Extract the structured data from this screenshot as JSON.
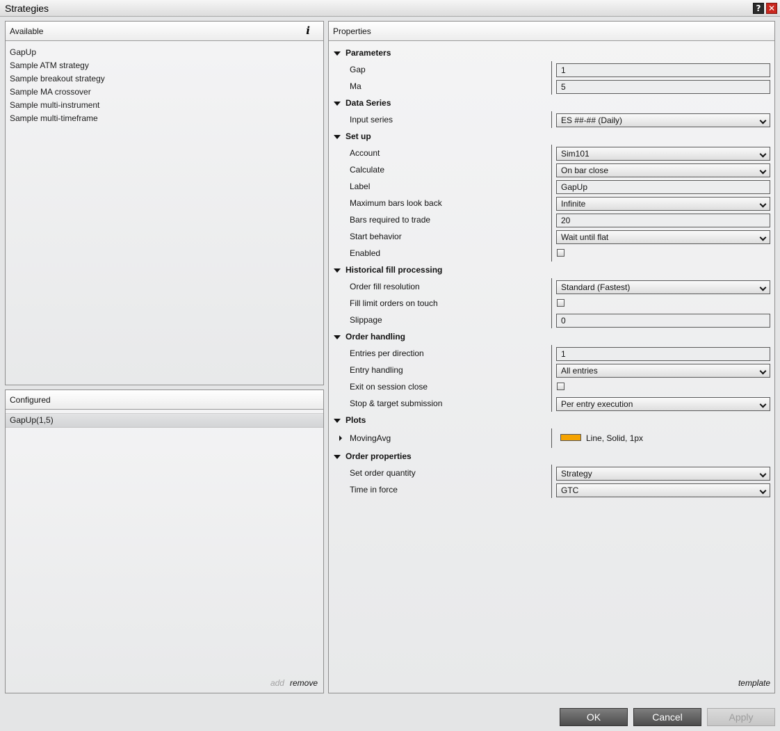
{
  "window": {
    "title": "Strategies",
    "help_label": "?",
    "close_label": "✕"
  },
  "available": {
    "header": "Available",
    "info_label": "i",
    "items": [
      "GapUp",
      "Sample ATM strategy",
      "Sample breakout strategy",
      "Sample MA crossover",
      "Sample multi-instrument",
      "Sample multi-timeframe"
    ]
  },
  "configured": {
    "header": "Configured",
    "items": [
      "GapUp(1,5)"
    ],
    "add_label": "add",
    "remove_label": "remove"
  },
  "properties": {
    "header": "Properties",
    "template_label": "template",
    "sections": {
      "parameters": {
        "title": "Parameters",
        "gap": {
          "label": "Gap",
          "value": "1"
        },
        "ma": {
          "label": "Ma",
          "value": "5"
        }
      },
      "data_series": {
        "title": "Data Series",
        "input_series": {
          "label": "Input series",
          "value": "ES ##-## (Daily)"
        }
      },
      "setup": {
        "title": "Set up",
        "account": {
          "label": "Account",
          "value": "Sim101"
        },
        "calculate": {
          "label": "Calculate",
          "value": "On bar close"
        },
        "label_field": {
          "label": "Label",
          "value": "GapUp"
        },
        "max_bars_look_back": {
          "label": "Maximum bars look back",
          "value": "Infinite"
        },
        "bars_required": {
          "label": "Bars required to trade",
          "value": "20"
        },
        "start_behavior": {
          "label": "Start behavior",
          "value": "Wait until flat"
        },
        "enabled": {
          "label": "Enabled",
          "checked": false
        }
      },
      "historical_fill": {
        "title": "Historical fill processing",
        "order_fill_resolution": {
          "label": "Order fill resolution",
          "value": "Standard (Fastest)"
        },
        "fill_limit_on_touch": {
          "label": "Fill limit orders on touch",
          "checked": false
        },
        "slippage": {
          "label": "Slippage",
          "value": "0"
        }
      },
      "order_handling": {
        "title": "Order handling",
        "entries_per_direction": {
          "label": "Entries per direction",
          "value": "1"
        },
        "entry_handling": {
          "label": "Entry handling",
          "value": "All entries"
        },
        "exit_on_session_close": {
          "label": "Exit on session close",
          "checked": false
        },
        "stop_target_submission": {
          "label": "Stop & target submission",
          "value": "Per entry execution"
        }
      },
      "plots": {
        "title": "Plots",
        "moving_avg": {
          "label": "MovingAvg",
          "value": "Line, Solid, 1px",
          "color": "#f5a300"
        }
      },
      "order_properties": {
        "title": "Order properties",
        "set_order_quantity": {
          "label": "Set order quantity",
          "value": "Strategy"
        },
        "time_in_force": {
          "label": "Time in force",
          "value": "GTC"
        }
      }
    }
  },
  "buttons": {
    "ok": "OK",
    "cancel": "Cancel",
    "apply": "Apply"
  }
}
